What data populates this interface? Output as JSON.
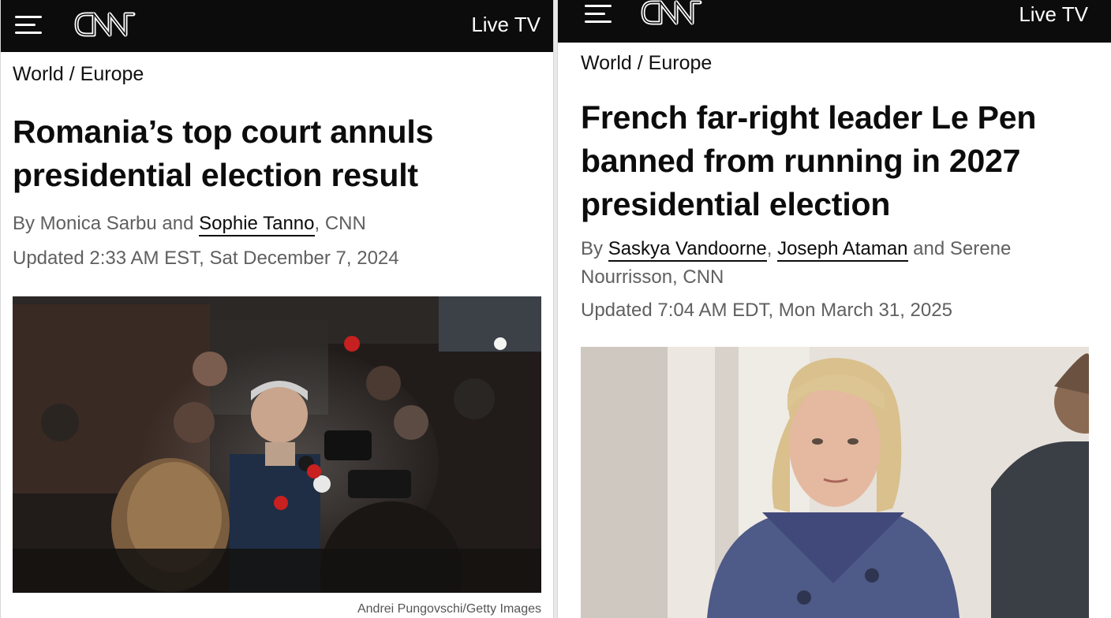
{
  "left_article": {
    "header": {
      "live_tv": "Live TV"
    },
    "breadcrumb": "World / Europe",
    "headline": "Romania’s top court annuls presidential election result",
    "byline": {
      "prefix": "By Monica Sarbu and ",
      "author_link": "Sophie Tanno",
      "suffix": ", CNN"
    },
    "timestamp": "Updated 2:33 AM EST, Sat December 7, 2024",
    "photo_credit": "Andrei Pungovschi/Getty Images"
  },
  "right_article": {
    "header": {
      "live_tv": "Live TV"
    },
    "breadcrumb": "World / Europe",
    "headline": "French far-right leader Le Pen banned from running in 2027 presidential election",
    "byline": {
      "prefix": "By ",
      "author_link_1": "Saskya Vandoorne",
      "sep": ", ",
      "author_link_2": "Joseph Ataman",
      "suffix": " and Serene Nourrisson, CNN"
    },
    "timestamp": "Updated 7:04 AM EDT, Mon March 31, 2025"
  },
  "colors": {
    "header_bg": "#0c0c0c",
    "text_primary": "#0c0c0c",
    "text_secondary": "#606060"
  },
  "icons": [
    "menu-icon",
    "cnn-logo"
  ]
}
